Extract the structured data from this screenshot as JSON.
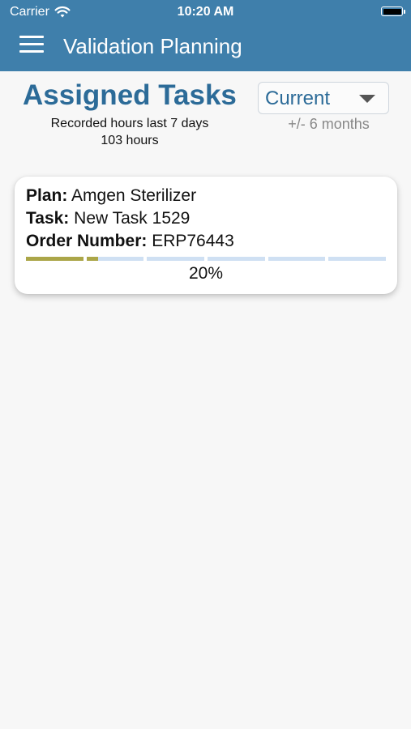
{
  "status_bar": {
    "carrier": "Carrier",
    "time": "10:20 AM"
  },
  "nav": {
    "title": "Validation Planning"
  },
  "summary": {
    "title": "Assigned Tasks",
    "recorded_label": "Recorded hours last 7 days",
    "recorded_value": "103 hours"
  },
  "filter": {
    "selected": "Current",
    "hint": "+/- 6 months"
  },
  "tasks": [
    {
      "plan_label": "Plan:",
      "plan": "Amgen Sterilizer",
      "task_label": "Task:",
      "task": "New Task 1529",
      "order_label": "Order Number:",
      "order": "ERP76443",
      "progress_text": "20%",
      "progress_fraction": 0.2,
      "segment_count": 6
    }
  ],
  "colors": {
    "header": "#3f7fab",
    "accent": "#2c6b98",
    "progress_done": "#aba648",
    "progress_remaining": "#cfe0f3"
  }
}
